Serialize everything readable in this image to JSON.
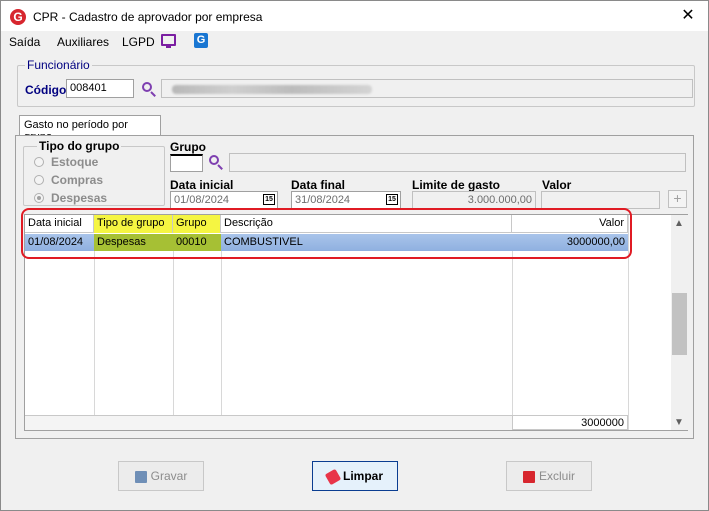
{
  "window": {
    "title": "CPR - Cadastro de aprovador por empresa",
    "close_glyph": "✕",
    "app_icon_glyph": "G"
  },
  "menu": {
    "items": [
      "Saída",
      "Auxiliares",
      "LGPD"
    ],
    "g_glyph": "G"
  },
  "funcionario": {
    "legend": "Funcionário",
    "codigo_label": "Código",
    "codigo_value": "008401"
  },
  "tab": {
    "label": "Gasto no período por grupo"
  },
  "tipo_grupo": {
    "legend": "Tipo do grupo",
    "options": [
      "Estoque",
      "Compras",
      "Despesas"
    ],
    "selected": "Despesas"
  },
  "filters": {
    "grupo_label": "Grupo",
    "data_inicial_label": "Data inicial",
    "data_inicial_value": "01/08/2024",
    "data_final_label": "Data final",
    "data_final_value": "31/08/2024",
    "limite_label": "Limite de gasto",
    "limite_value": "3.000.000,00",
    "valor_label": "Valor",
    "cal_glyph": "15",
    "plus_glyph": "+"
  },
  "table": {
    "headers": [
      "Data inicial",
      "Tipo de grupo",
      "Grupo",
      "Descrição",
      "Valor"
    ],
    "rows": [
      [
        "01/08/2024",
        "Despesas",
        "00010",
        "COMBUSTIVEL",
        "3000000,00"
      ]
    ],
    "total": "3000000",
    "scroll_up": "▲",
    "scroll_down": "▼"
  },
  "buttons": {
    "gravar": "Gravar",
    "limpar": "Limpar",
    "excluir": "Excluir"
  },
  "colors": {
    "highlight_yellow": "#f5f542",
    "selected_row": "#a9c4ea",
    "annotation_red": "#e01b24"
  }
}
